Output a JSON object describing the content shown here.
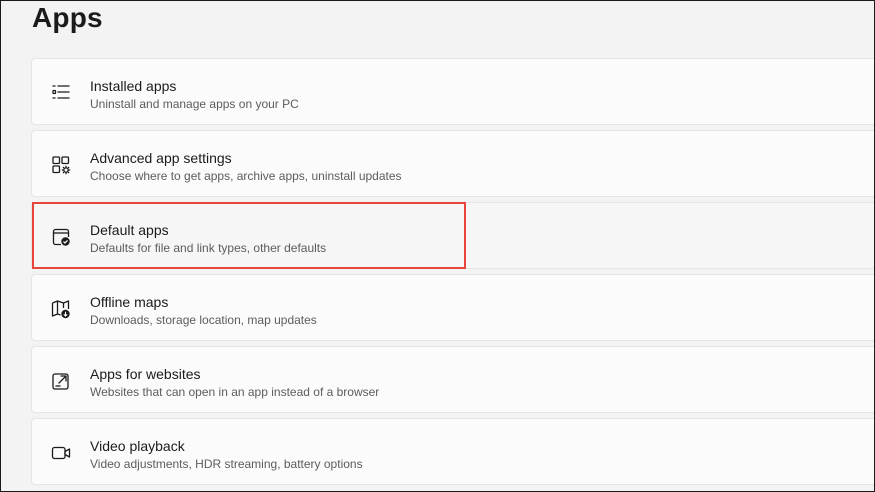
{
  "page": {
    "title": "Apps"
  },
  "items": [
    {
      "title": "Installed apps",
      "subtitle": "Uninstall and manage apps on your PC",
      "icon": "installed-apps-icon"
    },
    {
      "title": "Advanced app settings",
      "subtitle": "Choose where to get apps, archive apps, uninstall updates",
      "icon": "advanced-app-settings-icon"
    },
    {
      "title": "Default apps",
      "subtitle": "Defaults for file and link types, other defaults",
      "icon": "default-apps-icon",
      "highlighted": true
    },
    {
      "title": "Offline maps",
      "subtitle": "Downloads, storage location, map updates",
      "icon": "offline-maps-icon"
    },
    {
      "title": "Apps for websites",
      "subtitle": "Websites that can open in an app instead of a browser",
      "icon": "apps-for-websites-icon"
    },
    {
      "title": "Video playback",
      "subtitle": "Video adjustments, HDR streaming, battery options",
      "icon": "video-playback-icon"
    }
  ],
  "colors": {
    "highlight": "#e8453c",
    "card_bg": "#fbfbfb",
    "page_bg": "#f3f3f3"
  }
}
